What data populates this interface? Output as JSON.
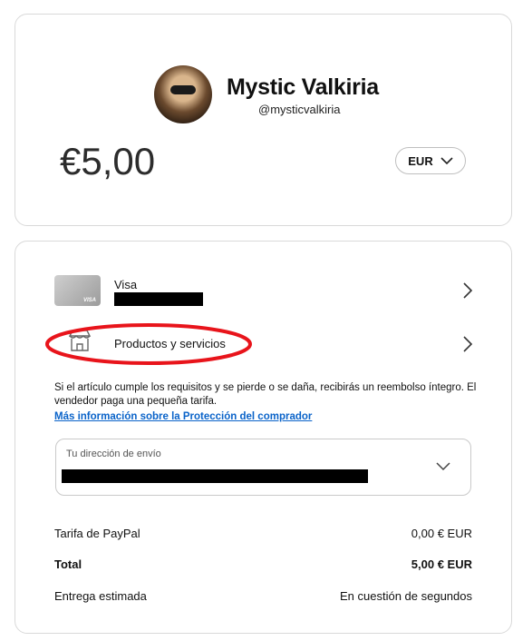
{
  "profile": {
    "name": "Mystic Valkiria",
    "handle": "@mysticvalkiria"
  },
  "payment": {
    "amount": "€5,00",
    "currency": "EUR"
  },
  "methods": {
    "visa_title": "Visa",
    "visa_brand": "VISA",
    "products_label": "Productos y servicios"
  },
  "protection": {
    "text": "Si el artículo cumple los requisitos y se pierde o se daña, recibirás un reembolso íntegro. El vendedor paga una pequeña tarifa.",
    "link": "Más información sobre la Protección del comprador"
  },
  "shipping": {
    "label": "Tu dirección de envío"
  },
  "summary": {
    "fee_label": "Tarifa de PayPal",
    "fee_value": "0,00 € EUR",
    "total_label": "Total",
    "total_value": "5,00 € EUR",
    "delivery_label": "Entrega estimada",
    "delivery_value": "En cuestión de segundos"
  },
  "colors": {
    "link": "#0a63c9",
    "annotation": "#e8141b",
    "border": "#d9d9d9"
  }
}
